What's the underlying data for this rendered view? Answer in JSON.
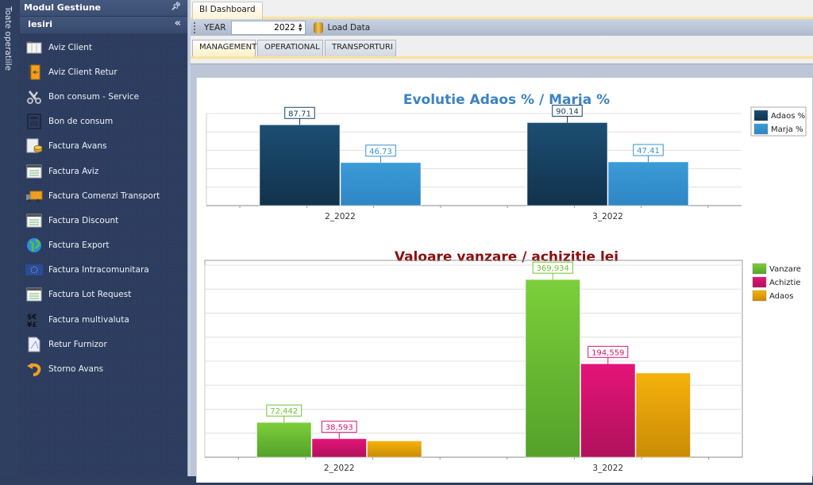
{
  "vertical_strip": {
    "label": "Toate operatiile"
  },
  "sidebar": {
    "header": "Modul Gestiune",
    "group": "Iesiri",
    "items": [
      {
        "label": "Aviz Client",
        "icon": "document-table-icon"
      },
      {
        "label": "Aviz Client Retur",
        "icon": "return-door-icon"
      },
      {
        "label": "Bon consum - Service",
        "icon": "wrench-icon"
      },
      {
        "label": "Bon de consum",
        "icon": "calculator-icon"
      },
      {
        "label": "Factura Avans",
        "icon": "invoice-coins-icon"
      },
      {
        "label": "Factura Aviz",
        "icon": "invoice-list-icon"
      },
      {
        "label": "Factura Comenzi Transport",
        "icon": "truck-icon"
      },
      {
        "label": "Factura Discount",
        "icon": "invoice-list-icon"
      },
      {
        "label": "Factura Export",
        "icon": "globe-icon"
      },
      {
        "label": "Factura Intracomunitara",
        "icon": "eu-flag-icon"
      },
      {
        "label": "Factura Lot Request",
        "icon": "invoice-list-icon"
      },
      {
        "label": "Factura multivaluta",
        "icon": "currency-icon"
      },
      {
        "label": "Retur Furnizor",
        "icon": "document-return-icon"
      },
      {
        "label": "Storno Avans",
        "icon": "undo-arrow-icon"
      }
    ]
  },
  "document_tab": "BI Dashboard",
  "toolbar": {
    "year_label": "YEAR",
    "year_value": "2022",
    "load_label": "Load Data"
  },
  "sub_tabs": [
    {
      "label": "MANAGEMENT",
      "active": true
    },
    {
      "label": "OPERATIONAL",
      "active": false
    },
    {
      "label": "TRANSPORTURI",
      "active": false
    }
  ],
  "colors": {
    "adaos_pct": "#17415f",
    "marja_pct": "#3791cf",
    "vanzare": "#6fc336",
    "achizitie": "#d91470",
    "adaos": "#f1ac08",
    "title1": "#3b82c4",
    "title2": "#8b0d0d"
  },
  "chart_data": [
    {
      "type": "bar",
      "title": "Evolutie Adaos % / Marja %",
      "categories": [
        "2_2022",
        "3_2022"
      ],
      "series": [
        {
          "name": "Adaos %",
          "values": [
            87.71,
            90.14
          ],
          "labels": [
            "87.71",
            "90.14"
          ]
        },
        {
          "name": "Marja %",
          "values": [
            46.73,
            47.41
          ],
          "labels": [
            "46.73",
            "47.41"
          ]
        }
      ],
      "xlabel": "",
      "ylabel": "",
      "ylim": [
        0,
        100
      ],
      "grid": true,
      "legend": "top-right"
    },
    {
      "type": "bar",
      "title": "Valoare vanzare / achizitie lei",
      "categories": [
        "2_2022",
        "3_2022"
      ],
      "series": [
        {
          "name": "Vanzare",
          "values": [
            72442,
            369934
          ],
          "labels": [
            "72,442",
            "369,934"
          ]
        },
        {
          "name": "Achiztie",
          "values": [
            38593,
            194559
          ],
          "labels": [
            "38,593",
            "194,559"
          ]
        },
        {
          "name": "Adaos",
          "values": [
            33849,
            175375
          ],
          "labels": [
            null,
            null
          ]
        }
      ],
      "xlabel": "",
      "ylabel": "",
      "ylim": [
        0,
        400000
      ],
      "grid": true,
      "legend": "top-right"
    }
  ]
}
